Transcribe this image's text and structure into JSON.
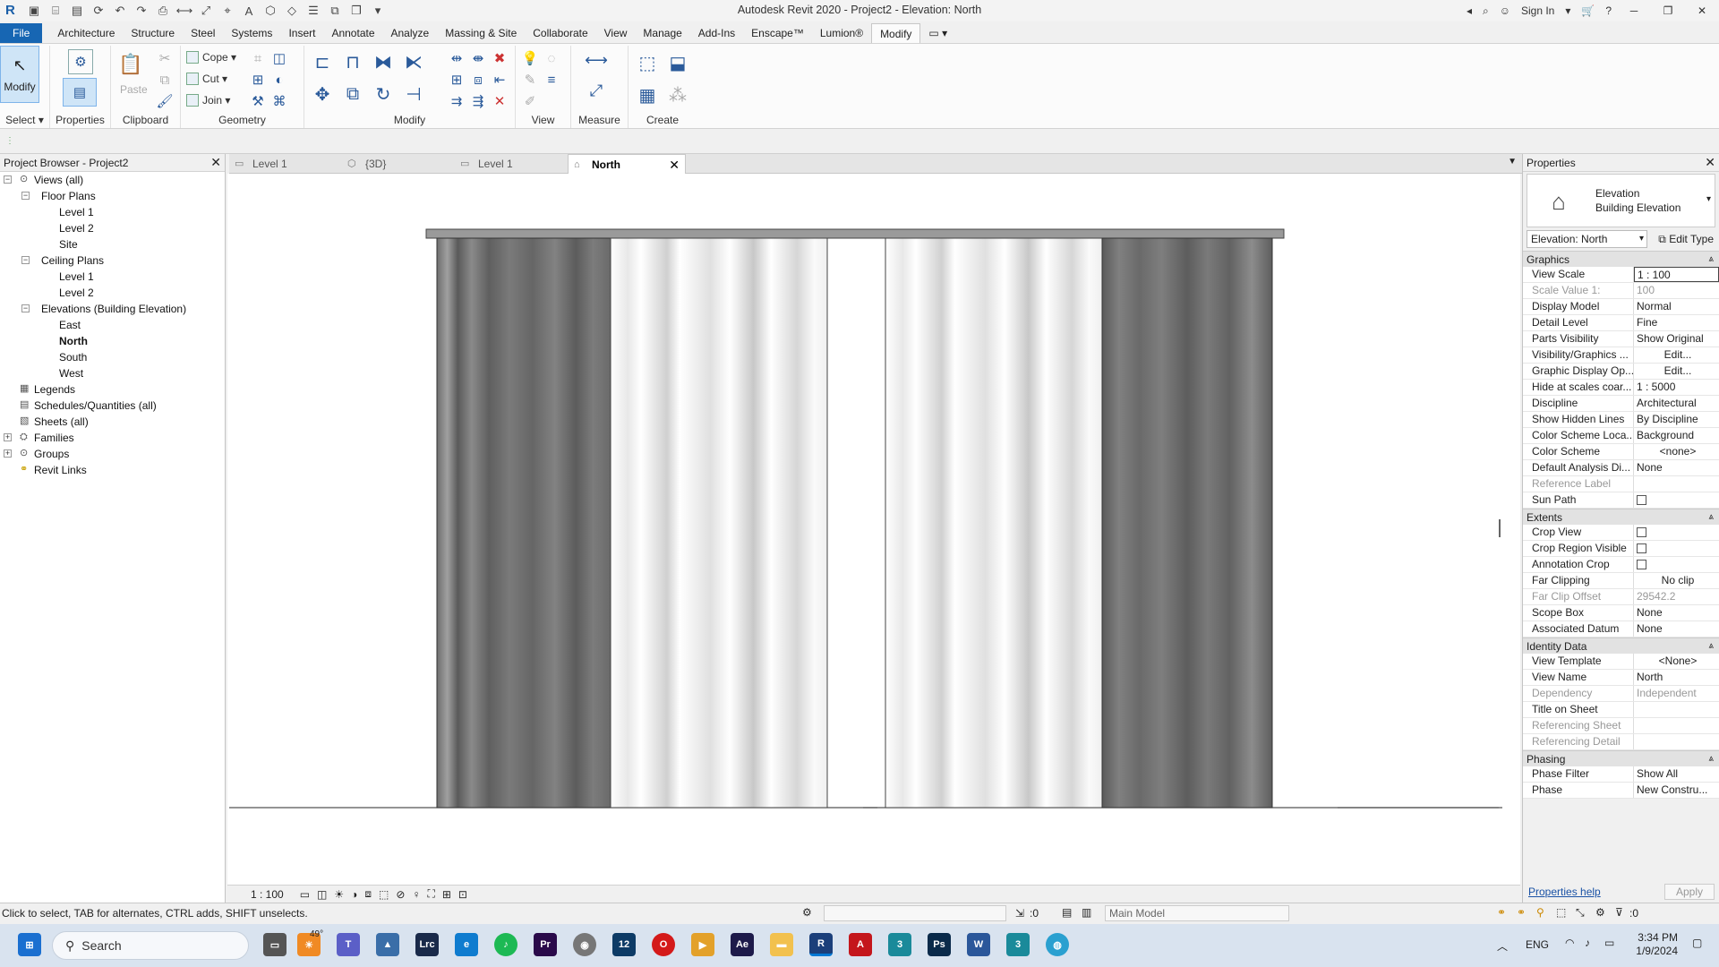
{
  "titlebar": {
    "title": "Autodesk Revit 2020 - Project2 - Elevation: North",
    "sign_in": "Sign In"
  },
  "menu_tabs": [
    "File",
    "Architecture",
    "Structure",
    "Steel",
    "Systems",
    "Insert",
    "Annotate",
    "Analyze",
    "Massing & Site",
    "Collaborate",
    "View",
    "Manage",
    "Add-Ins",
    "Enscape™",
    "Lumion®",
    "Modify"
  ],
  "ribbon": {
    "select_label": "Select",
    "modify_label": "Modify",
    "properties_label": "Properties",
    "paste_label": "Paste",
    "clipboard_label": "Clipboard",
    "cope_label": "Cope",
    "cut_label": "Cut",
    "join_label": "Join",
    "geometry_label": "Geometry",
    "modify_panel_label": "Modify",
    "view_label": "View",
    "measure_label": "Measure",
    "create_label": "Create"
  },
  "project_browser": {
    "title": "Project Browser - Project2",
    "nodes": [
      {
        "label": "Views (all)",
        "toggle": "−",
        "icon": "views"
      },
      {
        "label": "Floor Plans",
        "toggle": "−"
      },
      {
        "label": "Level 1"
      },
      {
        "label": "Level 2"
      },
      {
        "label": "Site"
      },
      {
        "label": "Ceiling Plans",
        "toggle": "−"
      },
      {
        "label": "Level 1"
      },
      {
        "label": "Level 2"
      },
      {
        "label": "Elevations (Building Elevation)",
        "toggle": "−"
      },
      {
        "label": "East"
      },
      {
        "label": "North",
        "selected": true
      },
      {
        "label": "South"
      },
      {
        "label": "West"
      },
      {
        "label": "Legends",
        "icon": "legends"
      },
      {
        "label": "Schedules/Quantities (all)",
        "icon": "schedules"
      },
      {
        "label": "Sheets (all)",
        "icon": "sheets"
      },
      {
        "label": "Families",
        "toggle": "+",
        "icon": "families"
      },
      {
        "label": "Groups",
        "toggle": "+",
        "icon": "groups"
      },
      {
        "label": "Revit Links",
        "icon": "links"
      }
    ]
  },
  "view_tabs": [
    {
      "label": "Level 1",
      "icon": "plan-icon"
    },
    {
      "label": "{3D}",
      "icon": "3d-icon"
    },
    {
      "label": "Level 1",
      "icon": "plan-icon"
    },
    {
      "label": "North",
      "icon": "elevation-icon",
      "active": true
    }
  ],
  "view_control": {
    "scale": "1 : 100"
  },
  "properties": {
    "title": "Properties",
    "type_name": "Elevation",
    "type_sub": "Building Elevation",
    "element_selector": "Elevation: North",
    "edit_type": "Edit Type",
    "groups": [
      {
        "name": "Graphics",
        "rows": [
          {
            "k": "View Scale",
            "v": "1 : 100",
            "boxed": true
          },
          {
            "k": "Scale Value   1:",
            "v": "100",
            "dis": true
          },
          {
            "k": "Display Model",
            "v": "Normal"
          },
          {
            "k": "Detail Level",
            "v": "Fine"
          },
          {
            "k": "Parts Visibility",
            "v": "Show Original"
          },
          {
            "k": "Visibility/Graphics ...",
            "v": "Edit...",
            "btn": true
          },
          {
            "k": "Graphic Display Op...",
            "v": "Edit...",
            "btn": true
          },
          {
            "k": "Hide at scales coar...",
            "v": "1 : 5000"
          },
          {
            "k": "Discipline",
            "v": "Architectural"
          },
          {
            "k": "Show Hidden Lines",
            "v": "By Discipline"
          },
          {
            "k": "Color Scheme Loca...",
            "v": "Background"
          },
          {
            "k": "Color Scheme",
            "v": "<none>",
            "btn": true
          },
          {
            "k": "Default Analysis Di...",
            "v": "None"
          },
          {
            "k": "Reference Label",
            "v": "",
            "dis": true
          },
          {
            "k": "Sun Path",
            "v": "",
            "chk": true
          }
        ]
      },
      {
        "name": "Extents",
        "rows": [
          {
            "k": "Crop View",
            "v": "",
            "chk": true
          },
          {
            "k": "Crop Region Visible",
            "v": "",
            "chk": true
          },
          {
            "k": "Annotation Crop",
            "v": "",
            "chk": true
          },
          {
            "k": "Far Clipping",
            "v": "No clip",
            "btn": true
          },
          {
            "k": "Far Clip Offset",
            "v": "29542.2",
            "dis": true
          },
          {
            "k": "Scope Box",
            "v": "None"
          },
          {
            "k": "Associated Datum",
            "v": "None"
          }
        ]
      },
      {
        "name": "Identity Data",
        "rows": [
          {
            "k": "View Template",
            "v": "<None>",
            "btn": true
          },
          {
            "k": "View Name",
            "v": "North"
          },
          {
            "k": "Dependency",
            "v": "Independent",
            "dis": true
          },
          {
            "k": "Title on Sheet",
            "v": ""
          },
          {
            "k": "Referencing Sheet",
            "v": "",
            "dis": true
          },
          {
            "k": "Referencing Detail",
            "v": "",
            "dis": true
          }
        ]
      },
      {
        "name": "Phasing",
        "rows": [
          {
            "k": "Phase Filter",
            "v": "Show All"
          },
          {
            "k": "Phase",
            "v": "New Constru..."
          }
        ]
      }
    ],
    "help_link": "Properties help",
    "apply": "Apply"
  },
  "status": {
    "message": "Click to select, TAB for alternates, CTRL adds, SHIFT unselects.",
    "count": ":0",
    "model": "Main Model",
    "filter_count": ":0"
  },
  "taskbar": {
    "search": "Search",
    "weather": "49°",
    "lang": "ENG",
    "time": "3:34 PM",
    "date": "1/9/2024"
  }
}
